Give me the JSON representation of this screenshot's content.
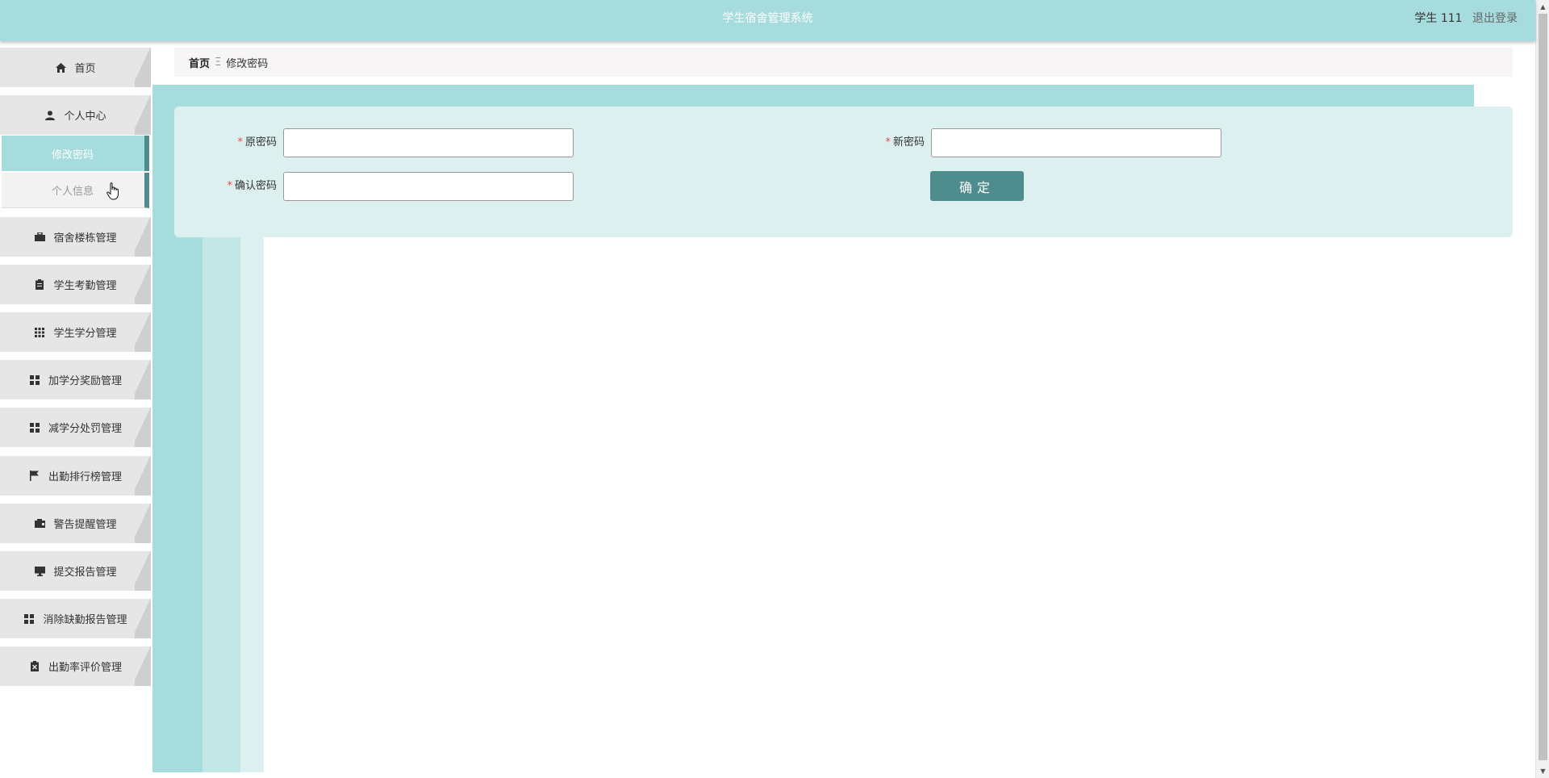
{
  "header": {
    "title": "学生宿舍管理系统",
    "username": "学生 111",
    "logout": "退出登录"
  },
  "sidebar": {
    "items": [
      {
        "label": "首页",
        "icon": "home-icon"
      },
      {
        "label": "个人中心",
        "icon": "user-icon"
      },
      {
        "label": "宿舍楼栋管理",
        "icon": "briefcase-icon"
      },
      {
        "label": "学生考勤管理",
        "icon": "clipboard-icon"
      },
      {
        "label": "学生学分管理",
        "icon": "grid-icon"
      },
      {
        "label": "加学分奖励管理",
        "icon": "apps-icon"
      },
      {
        "label": "减学分处罚管理",
        "icon": "apps-icon"
      },
      {
        "label": "出勤排行榜管理",
        "icon": "flag-icon"
      },
      {
        "label": "警告提醒管理",
        "icon": "wallet-icon"
      },
      {
        "label": "提交报告管理",
        "icon": "monitor-icon"
      },
      {
        "label": "消除缺勤报告管理",
        "icon": "apps-icon"
      },
      {
        "label": "出勤率评价管理",
        "icon": "clipboard-x-icon"
      }
    ],
    "submenu": {
      "active": "修改密码",
      "other": "个人信息"
    }
  },
  "breadcrumb": {
    "home": "首页",
    "separator": "Ξ",
    "current": "修改密码"
  },
  "form": {
    "old_password_label": "原密码",
    "new_password_label": "新密码",
    "confirm_password_label": "确认密码",
    "required_mark": "*",
    "old_password_value": "",
    "new_password_value": "",
    "confirm_password_value": "",
    "submit_label": "确定"
  },
  "colors": {
    "header": "#a6dcdd",
    "accent": "#4e8c8d",
    "panel": "#dcf0f0"
  }
}
